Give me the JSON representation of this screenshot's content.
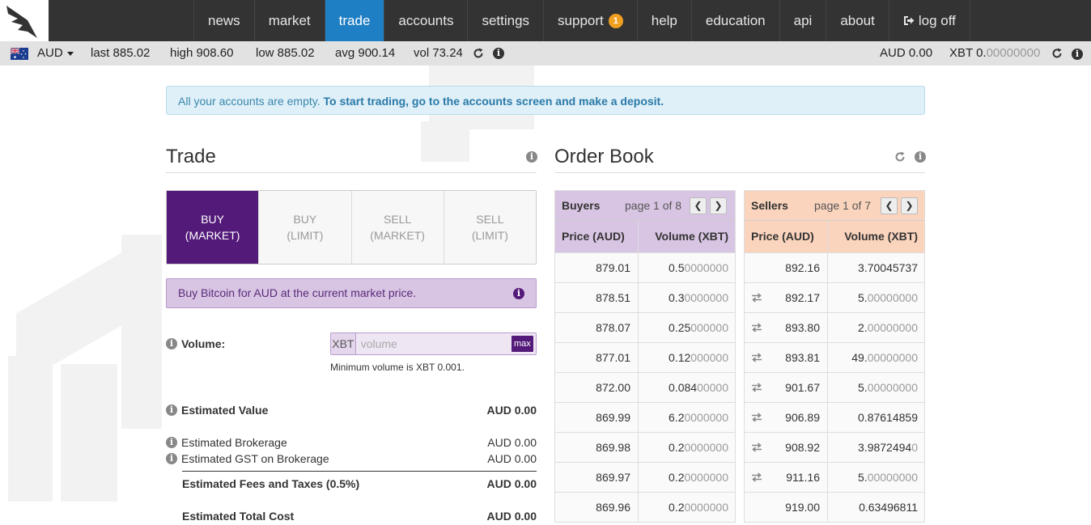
{
  "nav": {
    "items": [
      {
        "label": "news",
        "active": false
      },
      {
        "label": "market",
        "active": false
      },
      {
        "label": "trade",
        "active": true
      },
      {
        "label": "accounts",
        "active": false
      },
      {
        "label": "settings",
        "active": false
      },
      {
        "label": "support",
        "active": false,
        "badge": "1"
      },
      {
        "label": "help",
        "active": false
      },
      {
        "label": "education",
        "active": false
      },
      {
        "label": "api",
        "active": false
      },
      {
        "label": "about",
        "active": false
      },
      {
        "label": "log off",
        "active": false,
        "icon": "logoff-icon"
      }
    ],
    "active_color": "#1f7fc4",
    "badge_color": "#f0a020"
  },
  "ticker": {
    "currency": "AUD",
    "last": "last 885.02",
    "high": "high 908.60",
    "low": "low 885.02",
    "avg": "avg 900.14",
    "vol": "vol 73.24",
    "balance_aud": "AUD 0.00",
    "balance_xbt_label": "XBT 0.",
    "balance_xbt_grey": "00000000"
  },
  "alert": {
    "text": "All your accounts are empty.",
    "strong": "To start trading, go to the accounts screen and make a deposit."
  },
  "trade": {
    "title": "Trade",
    "tabs": [
      {
        "line1": "BUY",
        "line2": "(MARKET)",
        "active": true
      },
      {
        "line1": "BUY",
        "line2": "(LIMIT)",
        "active": false
      },
      {
        "line1": "SELL",
        "line2": "(MARKET)",
        "active": false
      },
      {
        "line1": "SELL",
        "line2": "(LIMIT)",
        "active": false
      }
    ],
    "description": "Buy Bitcoin for AUD at the current market price.",
    "volume_label": "Volume:",
    "volume_prefix": "XBT",
    "volume_placeholder": "volume",
    "max_label": "max",
    "min_volume": "Minimum volume is XBT 0.001.",
    "estimated_value_label": "Estimated Value",
    "estimated_value": "AUD 0.00",
    "brokerage_label": "Estimated Brokerage",
    "brokerage": "AUD 0.00",
    "gst_label": "Estimated GST on Brokerage",
    "gst": "AUD 0.00",
    "fees_label": "Estimated Fees and Taxes (0.5%)",
    "fees": "AUD 0.00",
    "total_label": "Estimated Total Cost",
    "total": "AUD 0.00"
  },
  "orderbook": {
    "title": "Order Book",
    "buyers": {
      "title": "Buyers",
      "page": "page 1 of 8",
      "col_price": "Price (AUD)",
      "col_volume": "Volume (XBT)",
      "rows": [
        {
          "price": "879.01",
          "vol": "0.5",
          "vol_grey": "0000000"
        },
        {
          "price": "878.51",
          "vol": "0.3",
          "vol_grey": "0000000"
        },
        {
          "price": "878.07",
          "vol": "0.25",
          "vol_grey": "000000"
        },
        {
          "price": "877.01",
          "vol": "0.12",
          "vol_grey": "000000"
        },
        {
          "price": "872.00",
          "vol": "0.084",
          "vol_grey": "00000"
        },
        {
          "price": "869.99",
          "vol": "6.2",
          "vol_grey": "0000000"
        },
        {
          "price": "869.98",
          "vol": "0.2",
          "vol_grey": "0000000"
        },
        {
          "price": "869.97",
          "vol": "0.2",
          "vol_grey": "0000000"
        },
        {
          "price": "869.96",
          "vol": "0.2",
          "vol_grey": "0000000"
        }
      ]
    },
    "sellers": {
      "title": "Sellers",
      "page": "page 1 of 7",
      "col_price": "Price (AUD)",
      "col_volume": "Volume (XBT)",
      "rows": [
        {
          "price": "892.16",
          "vol": "3.70045737",
          "vol_grey": "",
          "swap": false
        },
        {
          "price": "892.17",
          "vol": "5.",
          "vol_grey": "00000000",
          "swap": true
        },
        {
          "price": "893.80",
          "vol": "2.",
          "vol_grey": "00000000",
          "swap": true
        },
        {
          "price": "893.81",
          "vol": "49.",
          "vol_grey": "00000000",
          "swap": true
        },
        {
          "price": "901.67",
          "vol": "5.",
          "vol_grey": "00000000",
          "swap": true
        },
        {
          "price": "906.89",
          "vol": "0.87614859",
          "vol_grey": "",
          "swap": true
        },
        {
          "price": "908.92",
          "vol": "3.9872494",
          "vol_grey": "0",
          "swap": true
        },
        {
          "price": "911.16",
          "vol": "5.",
          "vol_grey": "00000000",
          "swap": true
        },
        {
          "price": "919.00",
          "vol": "0.63496811",
          "vol_grey": "",
          "swap": false
        }
      ]
    }
  }
}
